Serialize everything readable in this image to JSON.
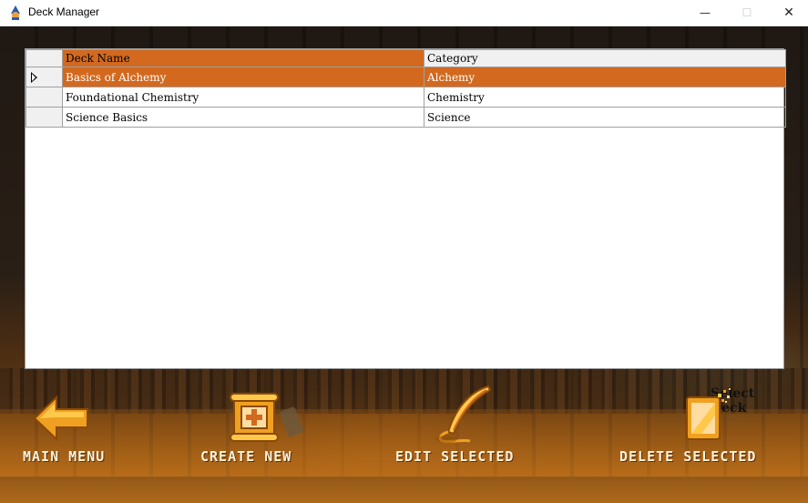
{
  "window": {
    "title": "Deck Manager",
    "minimize_glyph": "—",
    "maximize_glyph": "☐",
    "close_glyph": "✕"
  },
  "grid": {
    "columns": [
      "Deck Name",
      "Category"
    ],
    "rows": [
      {
        "name": "Basics of Alchemy",
        "category": "Alchemy",
        "selected": true
      },
      {
        "name": "Foundational Chemistry",
        "category": "Chemistry",
        "selected": false
      },
      {
        "name": "Science Basics",
        "category": "Science",
        "selected": false
      }
    ]
  },
  "select_label": "Select Deck",
  "actions": [
    {
      "label": "MAIN MENU",
      "icon": "back-arrow-icon"
    },
    {
      "label": "CREATE NEW",
      "icon": "scroll-plus-icon"
    },
    {
      "label": "EDIT SELECTED",
      "icon": "quill-icon"
    },
    {
      "label": "DELETE SELECTED",
      "icon": "disintegrating-card-icon"
    }
  ],
  "colors": {
    "selection": "#d2691e",
    "label_text": "#fff3dc",
    "accent_gold": "#f0a020"
  }
}
